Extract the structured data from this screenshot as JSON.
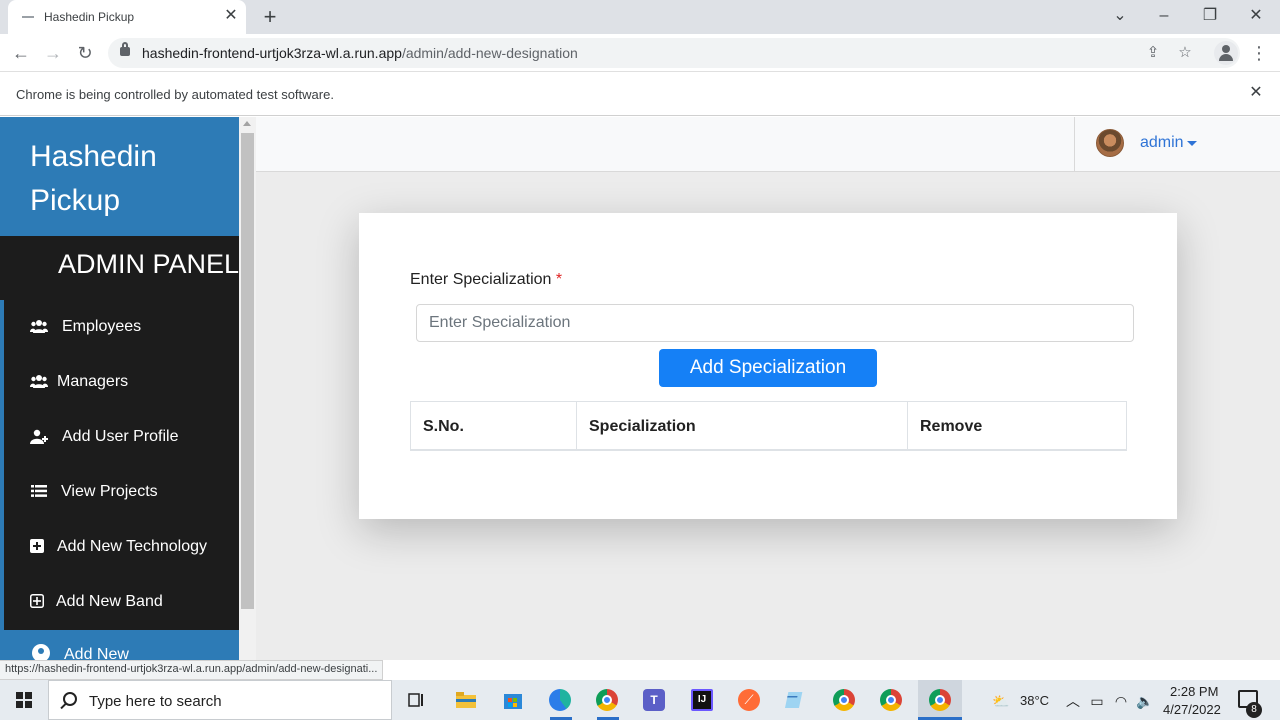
{
  "browser": {
    "tab_title": "Hashedin Pickup",
    "url_host": "hashedin-frontend-urtjok3rza-wl.a.run.app",
    "url_path": "/admin/add-new-designation",
    "infobar_text": "Chrome is being controlled by automated test software.",
    "status_url": "https://hashedin-frontend-urtjok3rza-wl.a.run.app/admin/add-new-designati..."
  },
  "sidebar": {
    "brand": "Hashedin Pickup",
    "panel_title": "ADMIN PANEL",
    "items": [
      {
        "label": "Employees",
        "icon": "users-icon"
      },
      {
        "label": "Managers",
        "icon": "users-icon"
      },
      {
        "label": "Add User Profile",
        "icon": "user-plus-icon"
      },
      {
        "label": "View Projects",
        "icon": "list-icon"
      },
      {
        "label": "Add New Technology",
        "icon": "plus-square-icon"
      },
      {
        "label": "Add New Band",
        "icon": "plus-square-outline-icon"
      },
      {
        "label": "Add New",
        "icon": "user-circle-icon"
      }
    ],
    "accent_color": "#2d7bb6"
  },
  "header": {
    "user": "admin"
  },
  "form": {
    "label": "Enter Specialization",
    "required_mark": "*",
    "input_value": "",
    "input_placeholder": "Enter Specialization",
    "button_label": "Add Specialization",
    "button_color": "#1580f6"
  },
  "table": {
    "columns": [
      "S.No.",
      "Specialization",
      "Remove"
    ],
    "rows": []
  },
  "taskbar": {
    "search_placeholder": "Type here to search",
    "temperature": "38°C",
    "time": "2:28 PM",
    "date": "4/27/2022",
    "notification_count": "8"
  }
}
